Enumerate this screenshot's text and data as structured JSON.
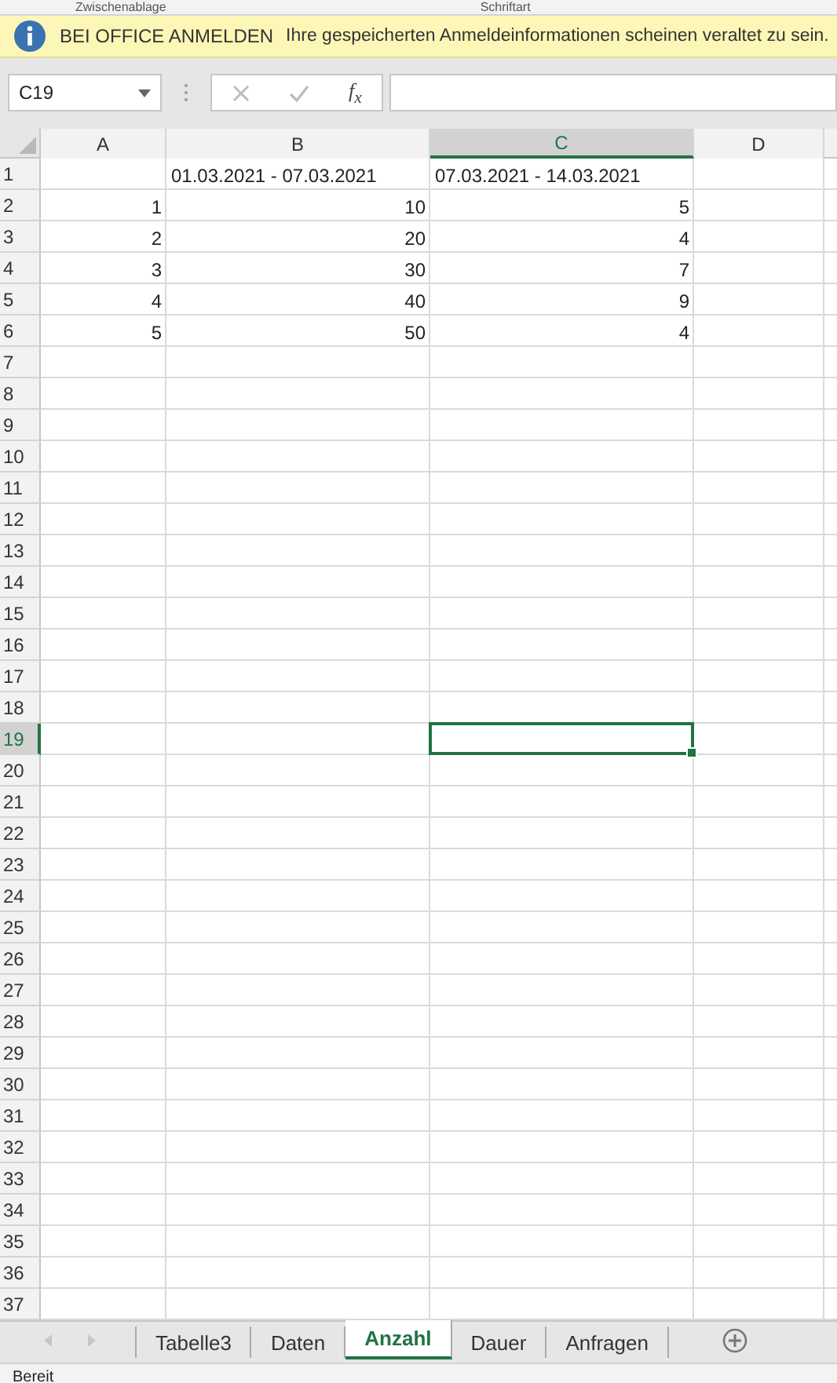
{
  "ribbon_groups": [
    {
      "label": "Zwischenablage"
    },
    {
      "label": "Schriftart"
    }
  ],
  "message_bar": {
    "title": "BEI OFFICE ANMELDEN",
    "text": "Ihre gespeicherten Anmeldeinformationen scheinen veraltet zu sein."
  },
  "formula_bar": {
    "name_box": "C19",
    "function_label": "f$_{x}$"
  },
  "columns": [
    {
      "label": "A",
      "selected": false
    },
    {
      "label": "B",
      "selected": false
    },
    {
      "label": "C",
      "selected": true
    },
    {
      "label": "D",
      "selected": false
    }
  ],
  "rows": [
    {
      "header": "1",
      "selected": false,
      "cells": [
        null,
        {
          "value": "01.03.2021 - 07.03.2021",
          "kind": "text"
        },
        {
          "value": "07.03.2021 - 14.03.2021",
          "kind": "text"
        },
        null
      ]
    },
    {
      "header": "2",
      "selected": false,
      "cells": [
        {
          "value": "1",
          "kind": "number"
        },
        {
          "value": "10",
          "kind": "number"
        },
        {
          "value": "5",
          "kind": "number"
        },
        null
      ]
    },
    {
      "header": "3",
      "selected": false,
      "cells": [
        {
          "value": "2",
          "kind": "number"
        },
        {
          "value": "20",
          "kind": "number"
        },
        {
          "value": "4",
          "kind": "number"
        },
        null
      ]
    },
    {
      "header": "4",
      "selected": false,
      "cells": [
        {
          "value": "3",
          "kind": "number"
        },
        {
          "value": "30",
          "kind": "number"
        },
        {
          "value": "7",
          "kind": "number"
        },
        null
      ]
    },
    {
      "header": "5",
      "selected": false,
      "cells": [
        {
          "value": "4",
          "kind": "number"
        },
        {
          "value": "40",
          "kind": "number"
        },
        {
          "value": "9",
          "kind": "number"
        },
        null
      ]
    },
    {
      "header": "6",
      "selected": false,
      "cells": [
        {
          "value": "5",
          "kind": "number"
        },
        {
          "value": "50",
          "kind": "number"
        },
        {
          "value": "4",
          "kind": "number"
        },
        null
      ]
    },
    {
      "header": "7",
      "selected": false
    },
    {
      "header": "8",
      "selected": false
    },
    {
      "header": "9",
      "selected": false
    },
    {
      "header": "10",
      "selected": false
    },
    {
      "header": "11",
      "selected": false
    },
    {
      "header": "12",
      "selected": false
    },
    {
      "header": "13",
      "selected": false
    },
    {
      "header": "14",
      "selected": false
    },
    {
      "header": "15",
      "selected": false
    },
    {
      "header": "16",
      "selected": false
    },
    {
      "header": "17",
      "selected": false
    },
    {
      "header": "18",
      "selected": false
    },
    {
      "header": "19",
      "selected": true
    },
    {
      "header": "20",
      "selected": false
    },
    {
      "header": "21",
      "selected": false
    },
    {
      "header": "22",
      "selected": false
    },
    {
      "header": "23",
      "selected": false
    },
    {
      "header": "24",
      "selected": false
    },
    {
      "header": "25",
      "selected": false
    },
    {
      "header": "26",
      "selected": false
    },
    {
      "header": "27",
      "selected": false
    },
    {
      "header": "28",
      "selected": false
    },
    {
      "header": "29",
      "selected": false
    },
    {
      "header": "30",
      "selected": false
    },
    {
      "header": "31",
      "selected": false
    },
    {
      "header": "32",
      "selected": false
    },
    {
      "header": "33",
      "selected": false
    },
    {
      "header": "34",
      "selected": false
    },
    {
      "header": "35",
      "selected": false
    },
    {
      "header": "36",
      "selected": false
    },
    {
      "header": "37",
      "selected": false
    }
  ],
  "sheet_tabs": [
    {
      "label": "Tabelle3",
      "selected": false
    },
    {
      "label": "Daten",
      "selected": false
    },
    {
      "label": "Anzahl",
      "selected": true
    },
    {
      "label": "Dauer",
      "selected": false
    },
    {
      "label": "Anfragen",
      "selected": false
    }
  ],
  "status_bar": {
    "text": "Bereit"
  }
}
